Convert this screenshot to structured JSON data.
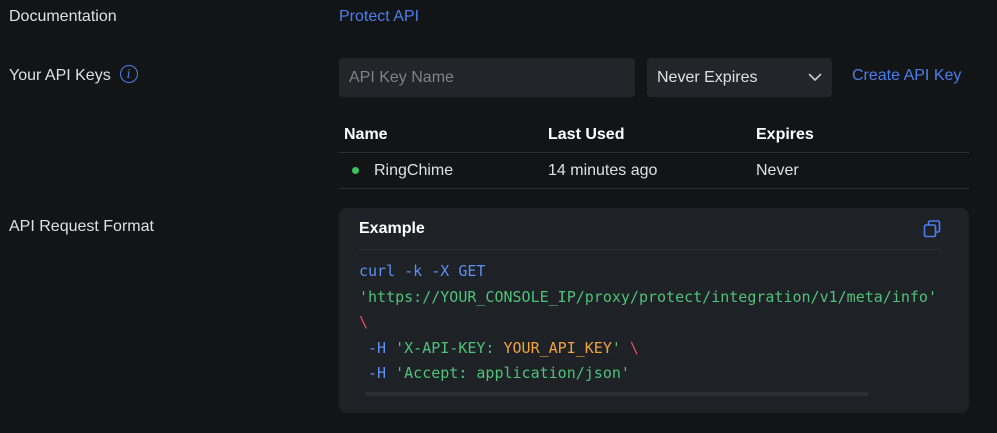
{
  "documentation": {
    "label": "Documentation",
    "link": "Protect API"
  },
  "api_keys": {
    "label": "Your API Keys",
    "info_glyph": "i",
    "name_input_placeholder": "API Key Name",
    "expiry_select_value": "Never Expires",
    "create_link": "Create API Key",
    "table": {
      "headers": [
        "Name",
        "Last Used",
        "Expires"
      ],
      "rows": [
        {
          "name": "RingChime",
          "last_used": "14 minutes ago",
          "expires": "Never",
          "status_color": "#3cc062"
        }
      ]
    }
  },
  "request_format": {
    "label": "API Request Format",
    "example_title": "Example",
    "code": {
      "line1": "curl -k -X GET",
      "line2": "'https://YOUR_CONSOLE_IP/proxy/protect/integration/v1/meta/info'",
      "line3": "\\",
      "line4_flag": " -H ",
      "line4_str_a": "'X-API-KEY: ",
      "line4_key": "YOUR_API_KEY",
      "line4_str_b": "'",
      "line4_bs": " \\",
      "line5_flag": " -H ",
      "line5_str": "'Accept: application/json'"
    }
  },
  "colors": {
    "background": "#131416",
    "link": "#4a7ff0",
    "status_active": "#3cc062",
    "code_command": "#5d8ff5",
    "code_string": "#4ec27a",
    "code_key": "#f0a43c",
    "code_backslash": "#e44f5e"
  }
}
